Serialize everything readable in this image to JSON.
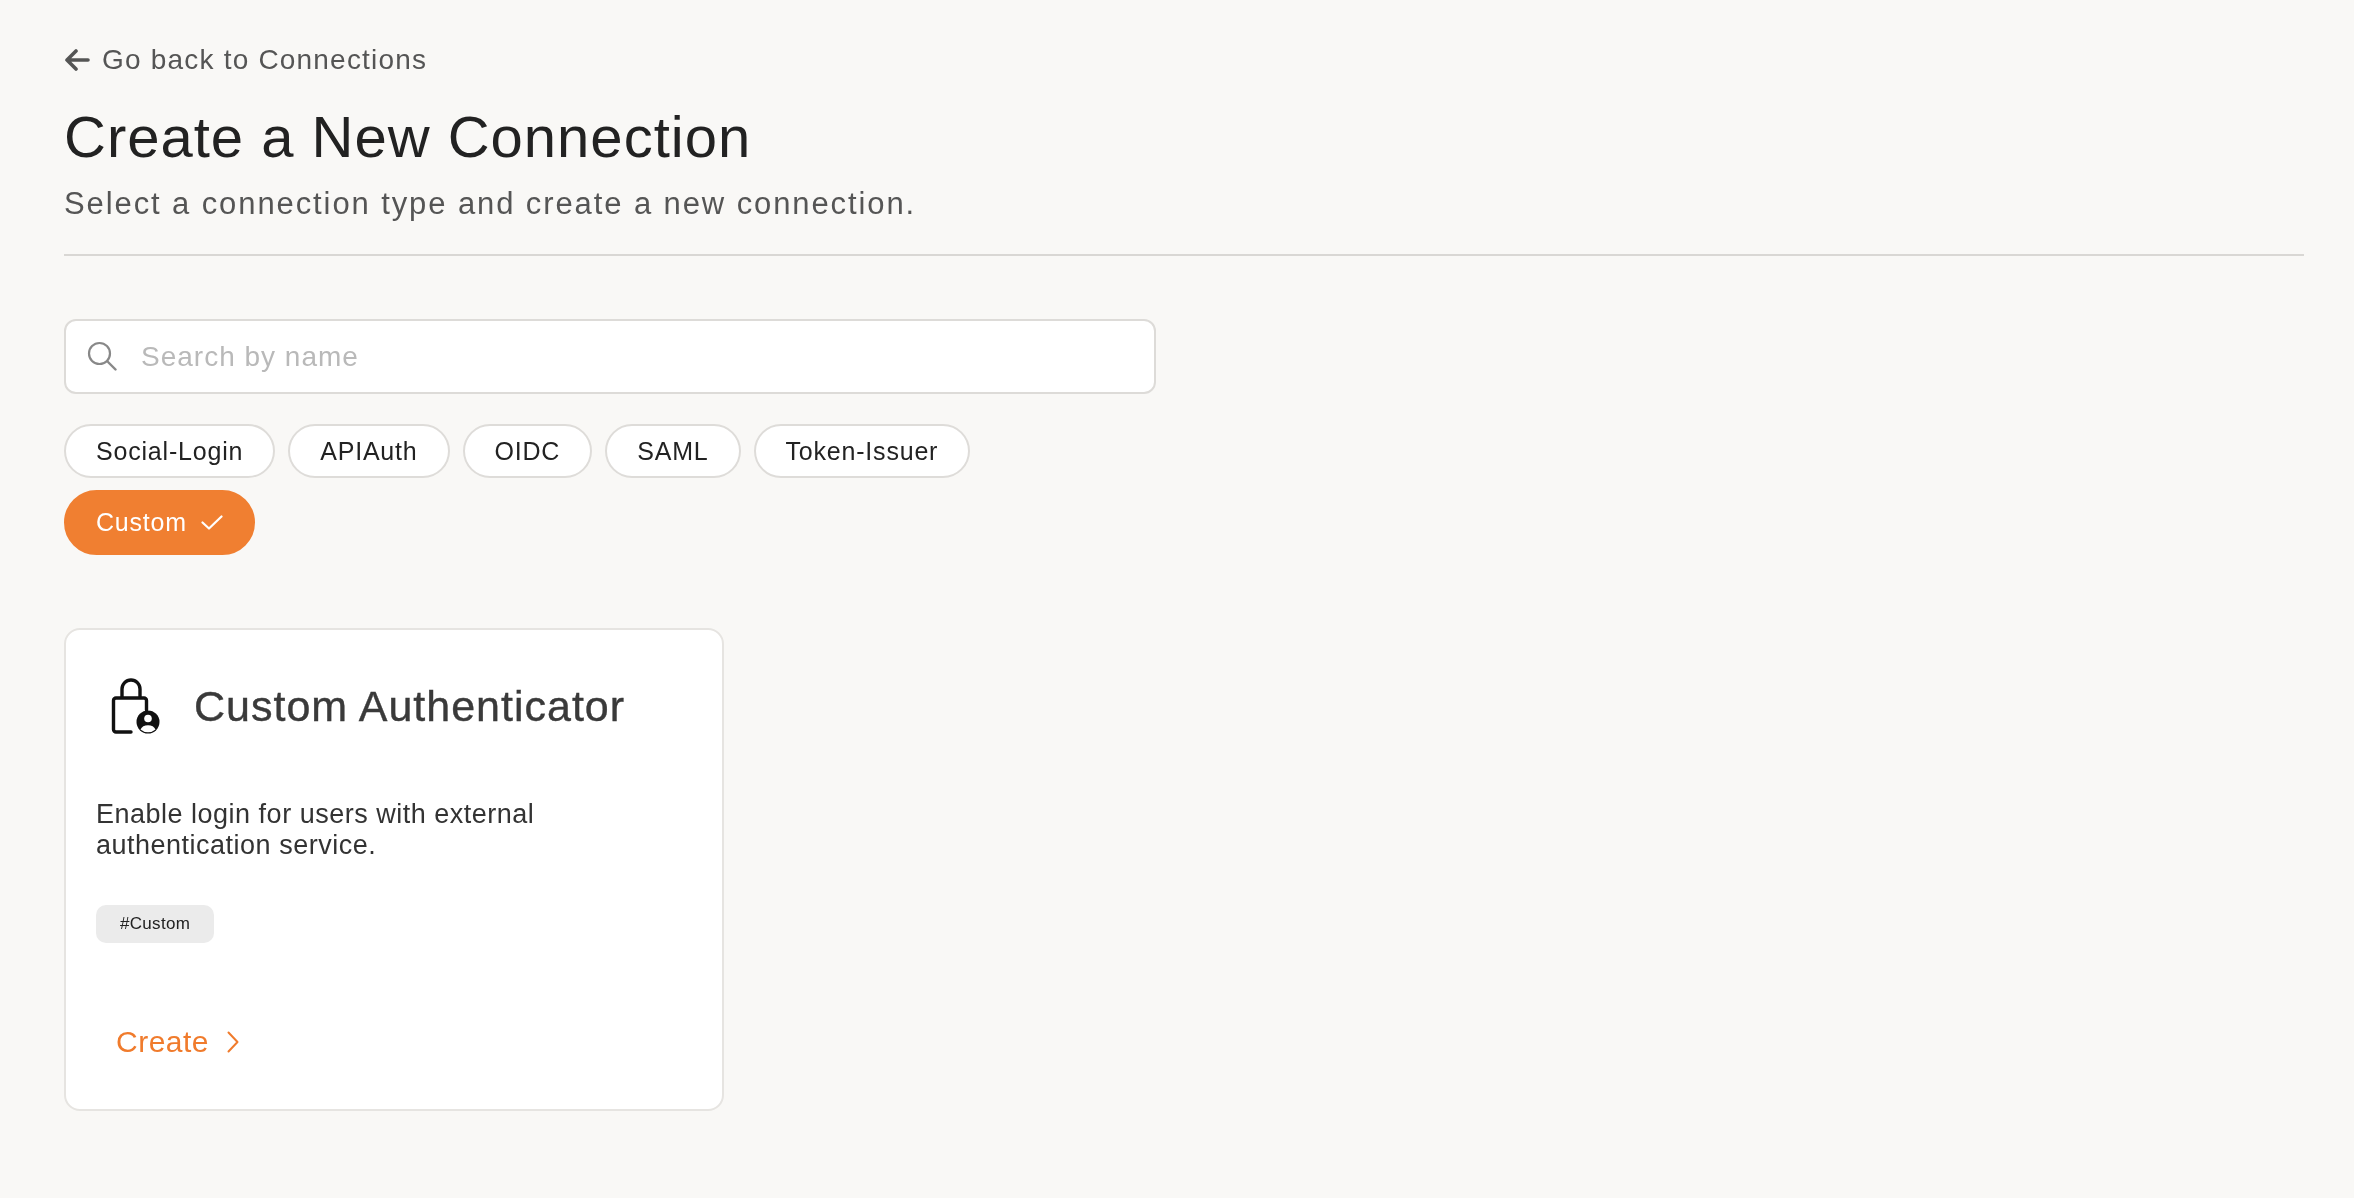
{
  "back_link": {
    "label": "Go back to Connections"
  },
  "header": {
    "title": "Create a New Connection",
    "subtitle": "Select a connection type and create a new connection."
  },
  "search": {
    "placeholder": "Search by name"
  },
  "filters": [
    {
      "label": "Social-Login",
      "selected": false
    },
    {
      "label": "APIAuth",
      "selected": false
    },
    {
      "label": "OIDC",
      "selected": false
    },
    {
      "label": "SAML",
      "selected": false
    },
    {
      "label": "Token-Issuer",
      "selected": false
    },
    {
      "label": "Custom",
      "selected": true
    }
  ],
  "cards": [
    {
      "title": "Custom Authenticator",
      "description": "Enable login for users with external authentication service.",
      "tags": [
        "#Custom"
      ],
      "action": "Create"
    }
  ]
}
